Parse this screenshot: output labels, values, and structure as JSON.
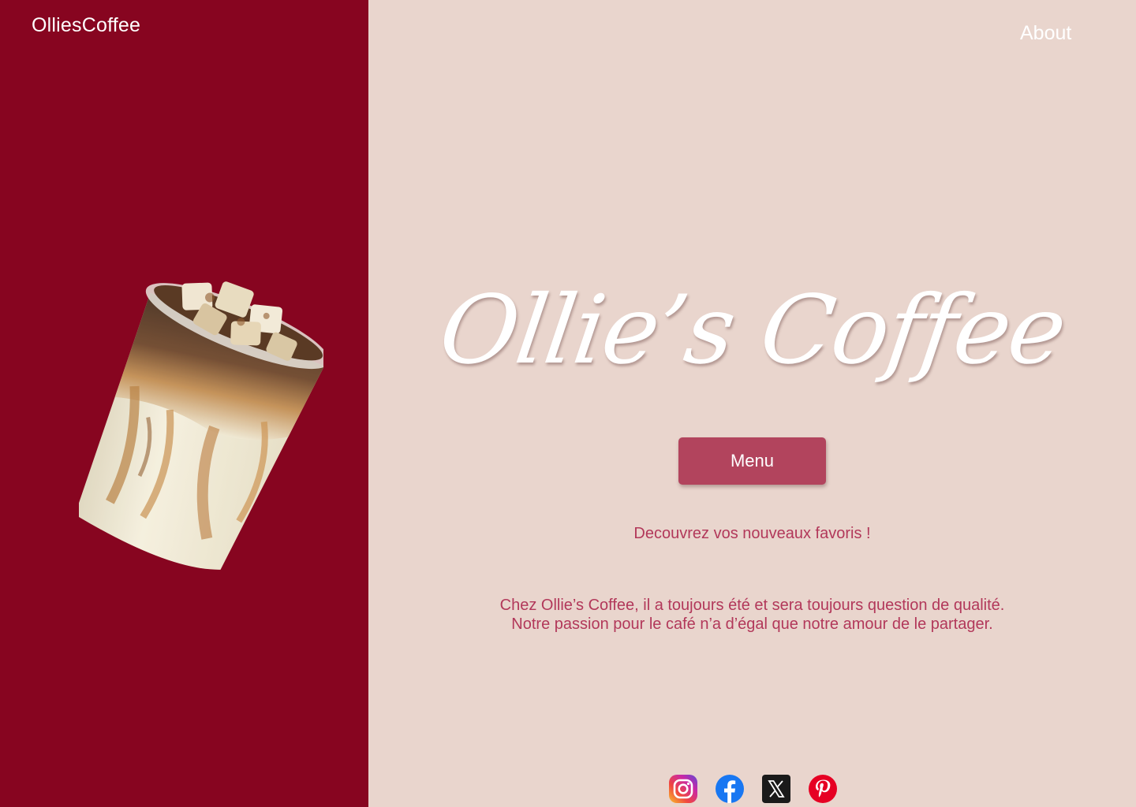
{
  "header": {
    "brand": "OlliesCoffee",
    "nav": {
      "about_label": "About"
    }
  },
  "hero": {
    "title": "Ollie’s Coffee",
    "menu_button_label": "Menu",
    "tagline": "Decouvrez vos nouveaux favoris !",
    "description_lines": [
      "Chez Ollie’s Coffee, il a toujours été et sera toujours question de qualité.",
      "Notre passion pour le café n’a d’égal que notre amour de le partager."
    ]
  },
  "image": {
    "subject": "iced-latte-cup"
  },
  "socials": [
    {
      "icon": "instagram-icon"
    },
    {
      "icon": "facebook-icon"
    },
    {
      "icon": "x-icon"
    },
    {
      "icon": "pinterest-icon"
    }
  ],
  "colors": {
    "left_panel": "#870520",
    "right_panel": "#e9d5cd",
    "accent": "#b2445d",
    "text_accent": "#b2385a",
    "title": "#ffffff"
  }
}
